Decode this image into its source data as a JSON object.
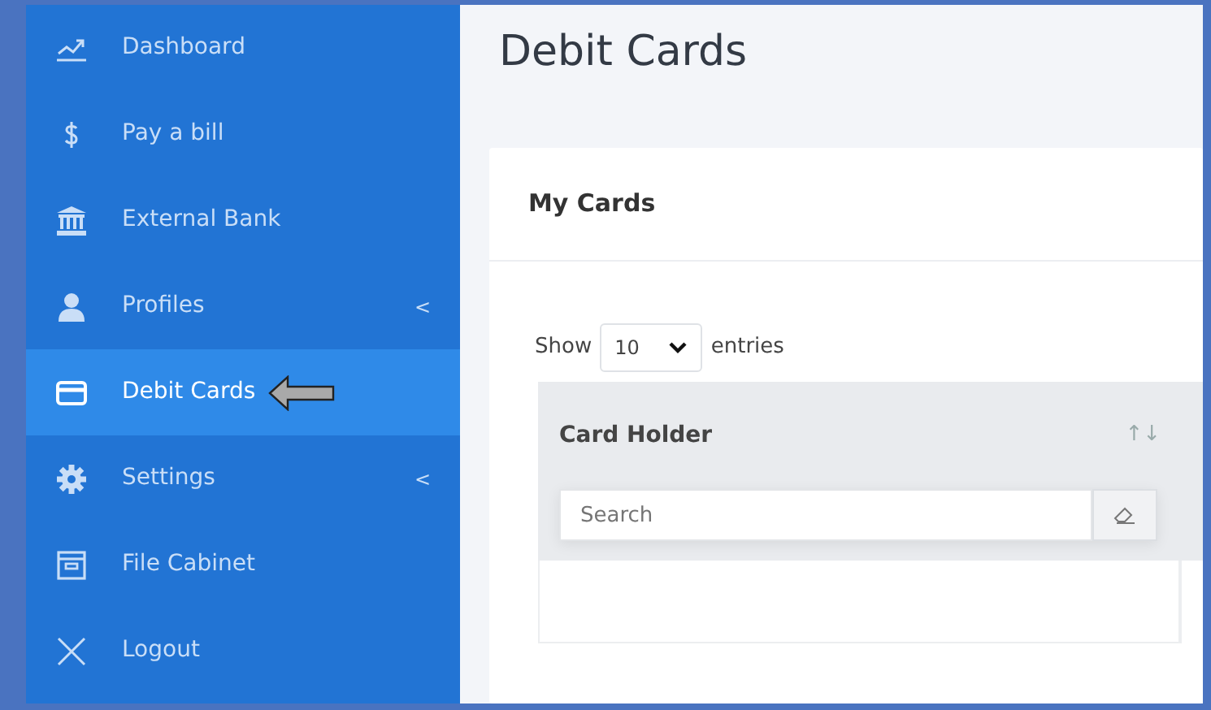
{
  "sidebar": {
    "items": [
      {
        "label": "Dashboard",
        "selected": false
      },
      {
        "label": "Pay a bill",
        "selected": false
      },
      {
        "label": "External Bank",
        "selected": false
      },
      {
        "label": "Profiles",
        "selected": false,
        "caret": "<"
      },
      {
        "label": "Debit Cards",
        "selected": true
      },
      {
        "label": "Settings",
        "selected": false,
        "caret": "<"
      },
      {
        "label": "File Cabinet",
        "selected": false
      },
      {
        "label": "Logout",
        "selected": false
      }
    ]
  },
  "page_title": "Debit Cards",
  "card": {
    "title": "My Cards",
    "length_menu": {
      "label_before": "Show",
      "value": "10",
      "label_after": "entries"
    },
    "table": {
      "columns": [
        {
          "label": "Card Holder",
          "sort_icon": "↑↓",
          "filter_placeholder": "Search"
        }
      ]
    }
  }
}
